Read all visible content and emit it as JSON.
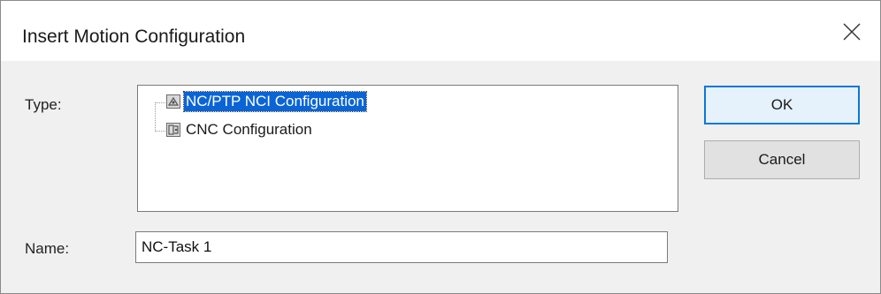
{
  "dialog": {
    "title": "Insert Motion Configuration",
    "close_icon": "close-icon"
  },
  "type_label": "Type:",
  "tree": {
    "items": [
      {
        "label": "NC/PTP NCI Configuration",
        "icon": "nc-ptp-config-icon",
        "selected": true
      },
      {
        "label": "CNC Configuration",
        "icon": "cnc-config-icon",
        "selected": false
      }
    ]
  },
  "name_label": "Name:",
  "name_value": "NC-Task 1",
  "buttons": {
    "ok": "OK",
    "cancel": "Cancel"
  },
  "colors": {
    "selection": "#0a64d6",
    "default_button_border": "#0a78d7",
    "dialog_background": "#f0f0f0"
  }
}
